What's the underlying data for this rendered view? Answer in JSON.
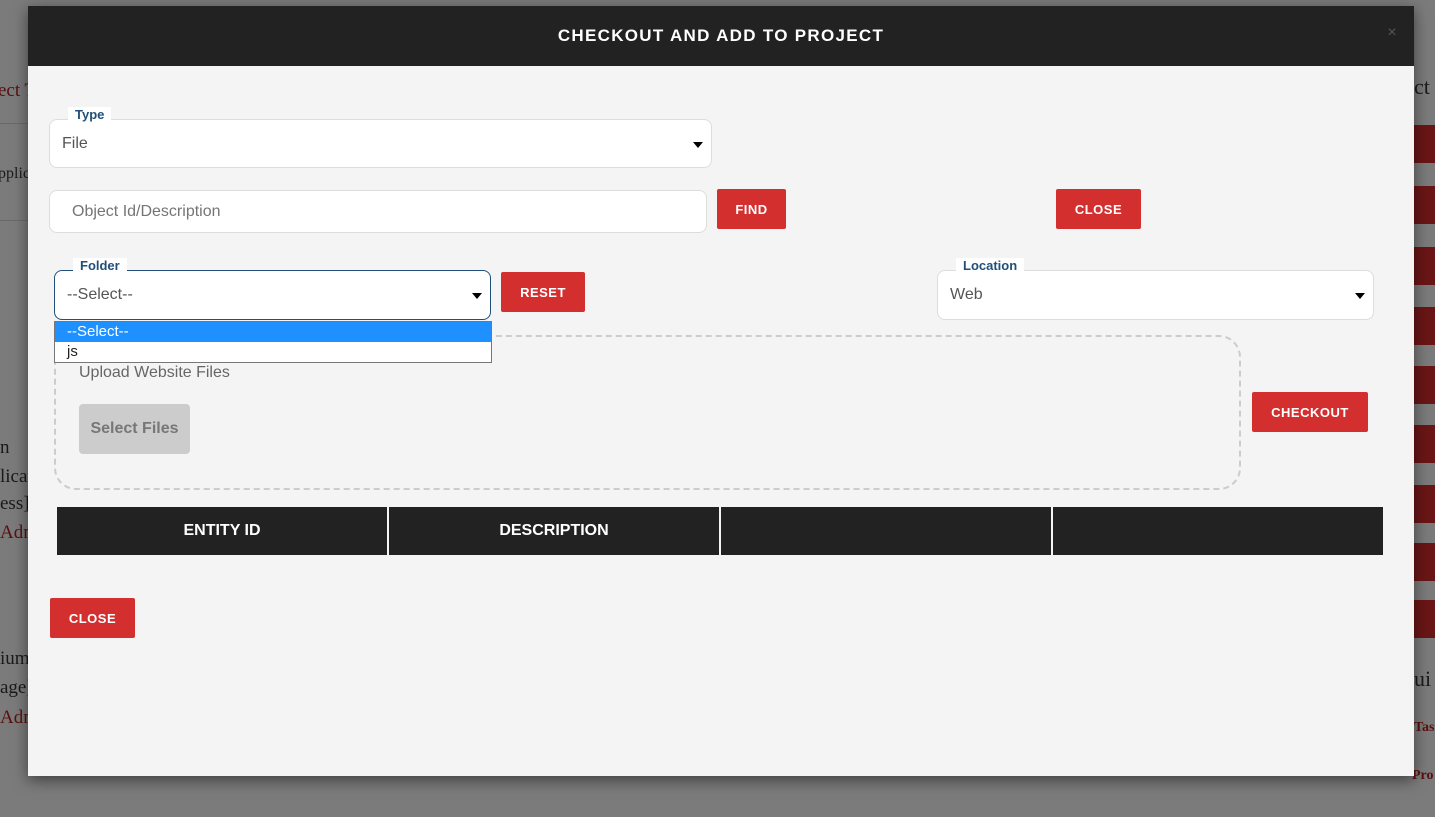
{
  "background": {
    "fragments": [
      "ect T",
      "pplic",
      "n",
      "licat",
      "ess]",
      "Adm",
      "ium",
      "age]",
      "Adm",
      "ct",
      "ui",
      "Tas",
      "Pro"
    ]
  },
  "modal": {
    "title": "CHECKOUT AND ADD TO PROJECT",
    "close_icon": "×",
    "type": {
      "label": "Type",
      "value": "File"
    },
    "search": {
      "placeholder": "Object Id/Description",
      "find_label": "FIND",
      "close_label": "CLOSE"
    },
    "folder": {
      "label": "Folder",
      "value": "--Select--",
      "options": [
        "--Select--",
        "js"
      ],
      "highlighted": "--Select--"
    },
    "reset_label": "RESET",
    "location": {
      "label": "Location",
      "value": "Web"
    },
    "upload": {
      "title": "Upload Website Files",
      "select_files_label": "Select Files"
    },
    "checkout_label": "CHECKOUT",
    "table": {
      "headers": [
        "ENTITY ID",
        "DESCRIPTION",
        "",
        ""
      ]
    },
    "footer_close_label": "CLOSE"
  }
}
